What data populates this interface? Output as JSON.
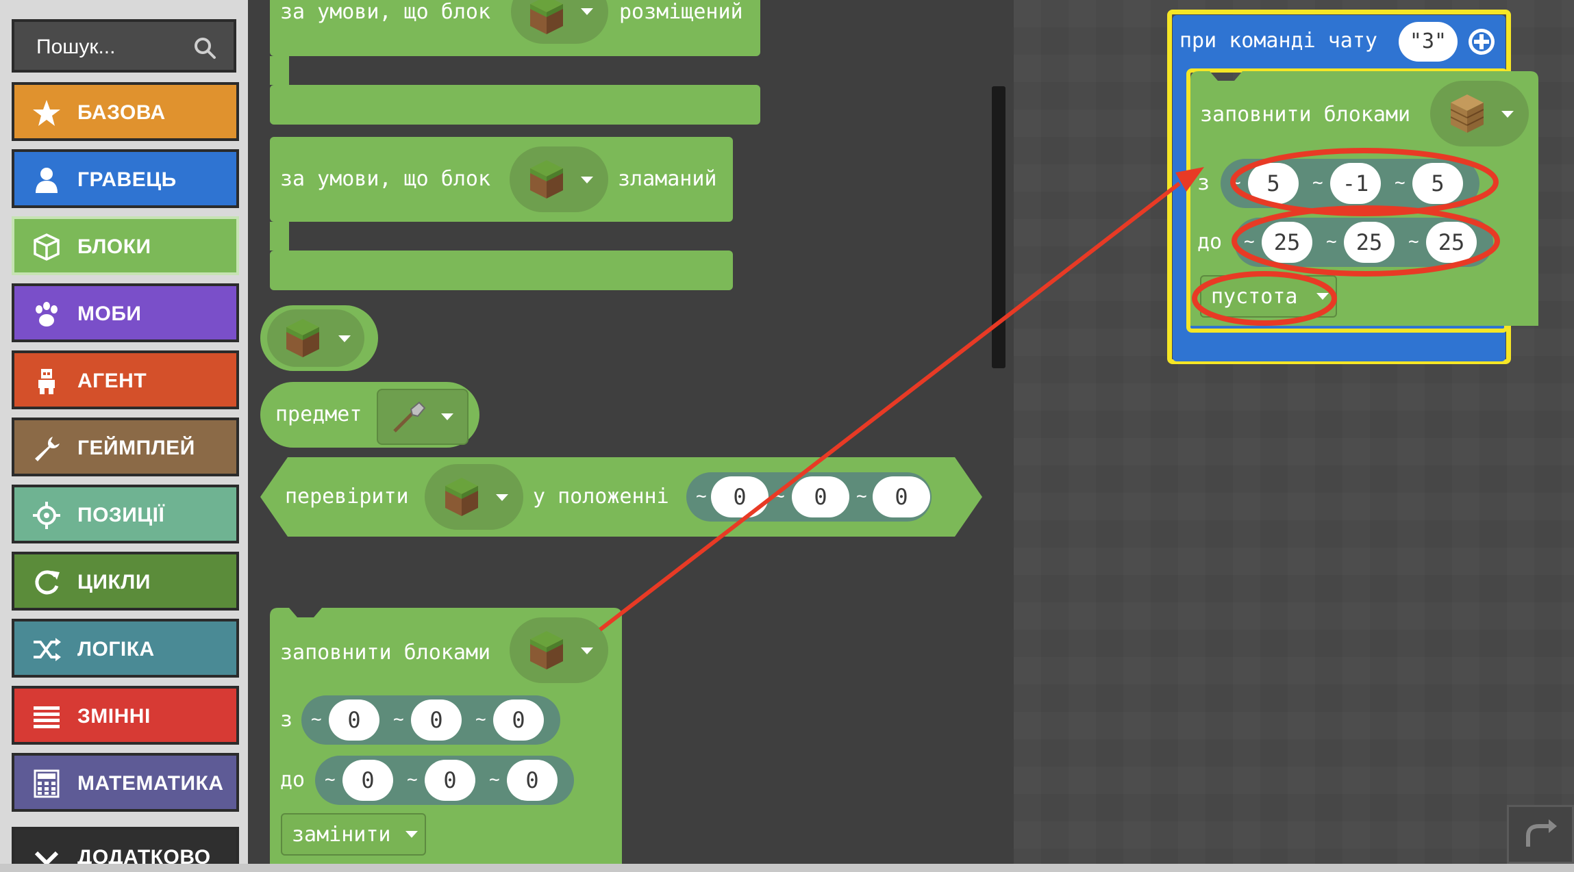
{
  "search": {
    "placeholder": "Пошук..."
  },
  "categories": [
    {
      "label": "БАЗОВА",
      "icon": "star-icon",
      "color": "#e0922e"
    },
    {
      "label": "ГРАВЕЦЬ",
      "icon": "person-icon",
      "color": "#2f74d2"
    },
    {
      "label": "БЛОКИ",
      "icon": "cube-icon",
      "color": "#7cb958"
    },
    {
      "label": "МОБИ",
      "icon": "paw-icon",
      "color": "#7a4fc9"
    },
    {
      "label": "АГЕНТ",
      "icon": "agent-icon",
      "color": "#d4502a"
    },
    {
      "label": "ГЕЙМПЛЕЙ",
      "icon": "wrench-icon",
      "color": "#8b6a47"
    },
    {
      "label": "ПОЗИЦІЇ",
      "icon": "crosshair-icon",
      "color": "#6fb392"
    },
    {
      "label": "ЦИКЛИ",
      "icon": "loop-icon",
      "color": "#5b8c3a"
    },
    {
      "label": "ЛОГІКА",
      "icon": "shuffle-icon",
      "color": "#4a8a95"
    },
    {
      "label": "ЗМІННІ",
      "icon": "list-icon",
      "color": "#d73a34"
    },
    {
      "label": "МАТЕМАТИКА",
      "icon": "calculator-icon",
      "color": "#5e5b96"
    },
    {
      "label": "ДОДАТКОВО",
      "icon": "chevron-down-icon",
      "color": "#2f2f2f"
    }
  ],
  "flyout": {
    "placed_block": {
      "pre": "за умови, що блок",
      "post": "розміщений"
    },
    "broken_block": {
      "pre": "за умови, що блок",
      "post": "зламаний"
    },
    "item_block": {
      "label": "предмет"
    },
    "check_block": {
      "pre": "перевірити",
      "mid": "у положенні",
      "x": "0",
      "y": "0",
      "z": "0"
    },
    "fill_block": {
      "label": "заповнити блоками",
      "from_label": "з",
      "from": [
        "0",
        "0",
        "0"
      ],
      "to_label": "до",
      "to": [
        "0",
        "0",
        "0"
      ],
      "mode": "замінити"
    }
  },
  "workspace": {
    "event": {
      "label": "при команді чату",
      "value": "\"3\""
    },
    "fill_block": {
      "label": "заповнити блоками",
      "from_label": "з",
      "from": [
        "5",
        "-1",
        "5"
      ],
      "to_label": "до",
      "to": [
        "25",
        "25",
        "25"
      ],
      "mode": "пустота"
    }
  },
  "colors": {
    "block_green": "#7cb958",
    "coord_pill": "#5e8c7a",
    "event_blue": "#2f74d2",
    "highlight_yellow": "#f5e626",
    "annotation_red": "#e83a25"
  }
}
